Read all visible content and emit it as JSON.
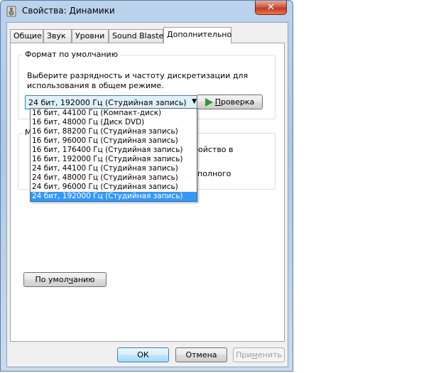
{
  "window": {
    "title": "Свойства: Динамики",
    "close_glyph": "✕"
  },
  "tabs": [
    {
      "label": "Общие",
      "active": false
    },
    {
      "label": "Звук",
      "active": false
    },
    {
      "label": "Уровни",
      "active": false
    },
    {
      "label": "Sound Blaster",
      "active": false
    },
    {
      "label": "Дополнительно",
      "active": true
    }
  ],
  "default_format": {
    "group_label": "Формат по умолчанию",
    "description_line1": "Выберите разрядность и частоту дискретизации для",
    "description_line2": "использования в общем режиме.",
    "selected_value": "24 бит, 192000 Гц (Студийная запись)",
    "test_button": {
      "prefix": "",
      "access_key": "П",
      "rest": "роверка",
      "icon": "play-icon"
    },
    "options": [
      "16 бит, 44100 Гц (Компакт-диск)",
      "16 бит, 48000 Гц (Диск DVD)",
      "16 бит, 88200 Гц (Студийная запись)",
      "16 бит, 96000 Гц (Студийная запись)",
      "16 бит, 176400 Гц (Студийная запись)",
      "16 бит, 192000 Гц (Студийная запись)",
      "24 бит, 44100 Гц (Студийная запись)",
      "24 бит, 48000 Гц (Студийная запись)",
      "24 бит, 96000 Гц (Студийная запись)",
      "24 бит, 192000 Гц (Студийная запись)"
    ],
    "selected_index": 9
  },
  "exclusive_mode": {
    "group_label_fragment": "М",
    "text_fragment_1": "ройство в",
    "text_fragment_2": "полного"
  },
  "restore_defaults": {
    "prefix": "По умол",
    "access_key": "ч",
    "rest": "анию"
  },
  "footer": {
    "ok_label": "ОК",
    "cancel_label": "Отмена",
    "apply": {
      "prefix": "При",
      "access_key": "м",
      "rest": "енить"
    }
  },
  "colors": {
    "selection": "#3399ff",
    "play_icon": "#2e9a2e",
    "close_button": "#c43a1d"
  }
}
